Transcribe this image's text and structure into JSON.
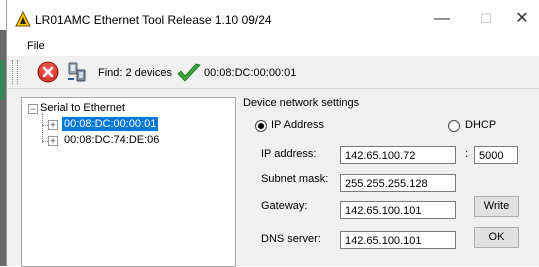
{
  "window": {
    "title": "LR01AMC Ethernet Tool Release 1.10 09/24",
    "minimize_glyph": "—",
    "maximize_glyph": "☐",
    "close_glyph": "✕"
  },
  "menu": {
    "file": "File"
  },
  "toolbar": {
    "stop_icon": "stop-icon",
    "find_icon": "network-find-icon",
    "find_label": "Find: 2 devices",
    "check_icon": "checkmark-icon",
    "selected_mac": "00:08:DC:00:00:01"
  },
  "tree": {
    "root_label": "Serial to Ethernet",
    "items": [
      {
        "label": "00:08:DC:00:00:01",
        "selected": true
      },
      {
        "label": "00:08:DC:74:DE:06",
        "selected": false
      }
    ]
  },
  "settings": {
    "group_title": "Device network settings",
    "mode_ip": "IP Address",
    "mode_dhcp": "DHCP",
    "selected_mode": "IP Address",
    "ip_label": "IP address:",
    "ip_value": "142.65.100.72",
    "port_sep": ":",
    "port_value": "5000",
    "subnet_label": "Subnet mask:",
    "subnet_value": "255.255.255.128",
    "gateway_label": "Gateway:",
    "gateway_value": "142.65.100.101",
    "dns_label": "DNS server:",
    "dns_value": "142.65.100.101",
    "write_button": "Write",
    "ok_button": "OK"
  },
  "colors": {
    "selection": "#0078d7",
    "check_green": "#3aa53a",
    "stop_red": "#d9342b"
  }
}
